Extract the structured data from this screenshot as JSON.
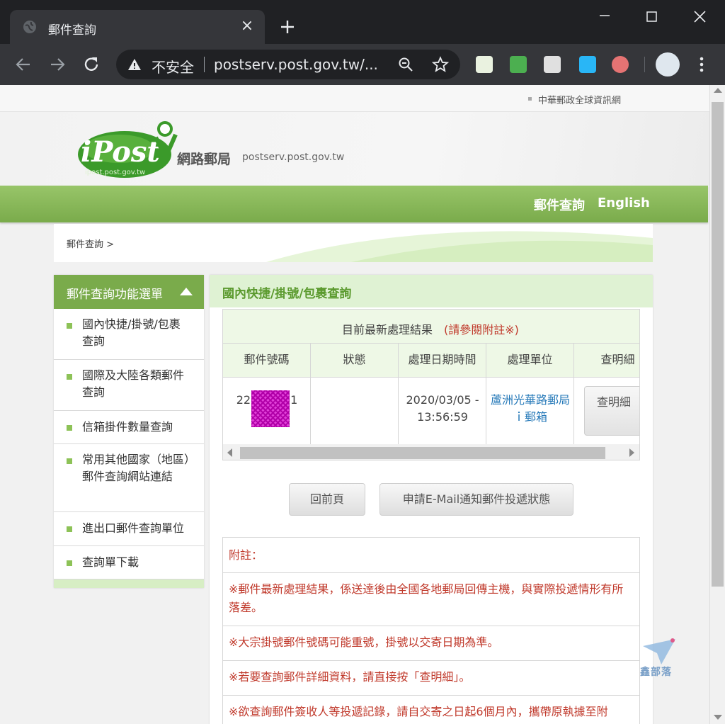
{
  "browser": {
    "tab_title": "郵件查詢",
    "tab_close": "×",
    "omnibox_security": "不安全",
    "omnibox_url": "postserv.post.gov.tw/..."
  },
  "page": {
    "top_link": "中華郵政全球資訊網",
    "logo_text": "iPost",
    "logo_subtext": "ipost.post.gov.tw",
    "site_name": "網路郵局",
    "site_domain": "postserv.post.gov.tw",
    "nav": {
      "mail_query": "郵件查詢",
      "english": "English"
    },
    "breadcrumb": "郵件查詢 >"
  },
  "sidebar": {
    "title": "郵件查詢功能選單",
    "items": [
      {
        "label": "國內快捷/掛號/包裹查詢"
      },
      {
        "label": "國際及大陸各類郵件查詢"
      },
      {
        "label": "信箱掛件數量查詢"
      },
      {
        "label": "常用其他國家（地區）郵件查詢網站連結"
      },
      {
        "label": "進出口郵件查詢單位"
      },
      {
        "label": "查詢單下載"
      }
    ]
  },
  "main": {
    "title": "國內快捷/掛號/包裹查詢",
    "result_caption": "目前最新處理結果",
    "result_note": "(請參閱附註※)",
    "columns": [
      "郵件號碼",
      "狀態",
      "處理日期時間",
      "處理單位",
      "查明細"
    ],
    "row": {
      "tracking_number": "22010 071",
      "status": "",
      "datetime": "2020/03/05 - 13:56:59",
      "unit": "蘆洲光華路郵局ｉ郵箱",
      "detail_button": "查明細"
    },
    "back_button": "回前頁",
    "email_button": "申請E-Mail通知郵件投遞狀態",
    "notes_title": "附註：",
    "notes": [
      "※郵件最新處理結果，係送達後由全國各地郵局回傳主機，與實際投遞情形有所落差。",
      "※大宗掛號郵件號碼可能重號，掛號以交寄日期為準。",
      "※若要查詢郵件詳細資料，請直接按「查明細」。",
      "※欲查詢郵件簽收人等投遞記錄，請自交寄之日起6個月內，攜帶原執據至附"
    ]
  },
  "watermark": "鑫部落",
  "colors": {
    "brand_green": "#7aab4b",
    "light_green": "#dff2d3",
    "note_red": "#c0392b",
    "link_blue": "#2478b8",
    "redaction": "#e040d8"
  },
  "icons": [
    "globe-icon",
    "close-icon",
    "plus-icon",
    "back-icon",
    "forward-icon",
    "reload-icon",
    "warning-icon",
    "zoom-icon",
    "star-icon",
    "kebab-icon"
  ]
}
